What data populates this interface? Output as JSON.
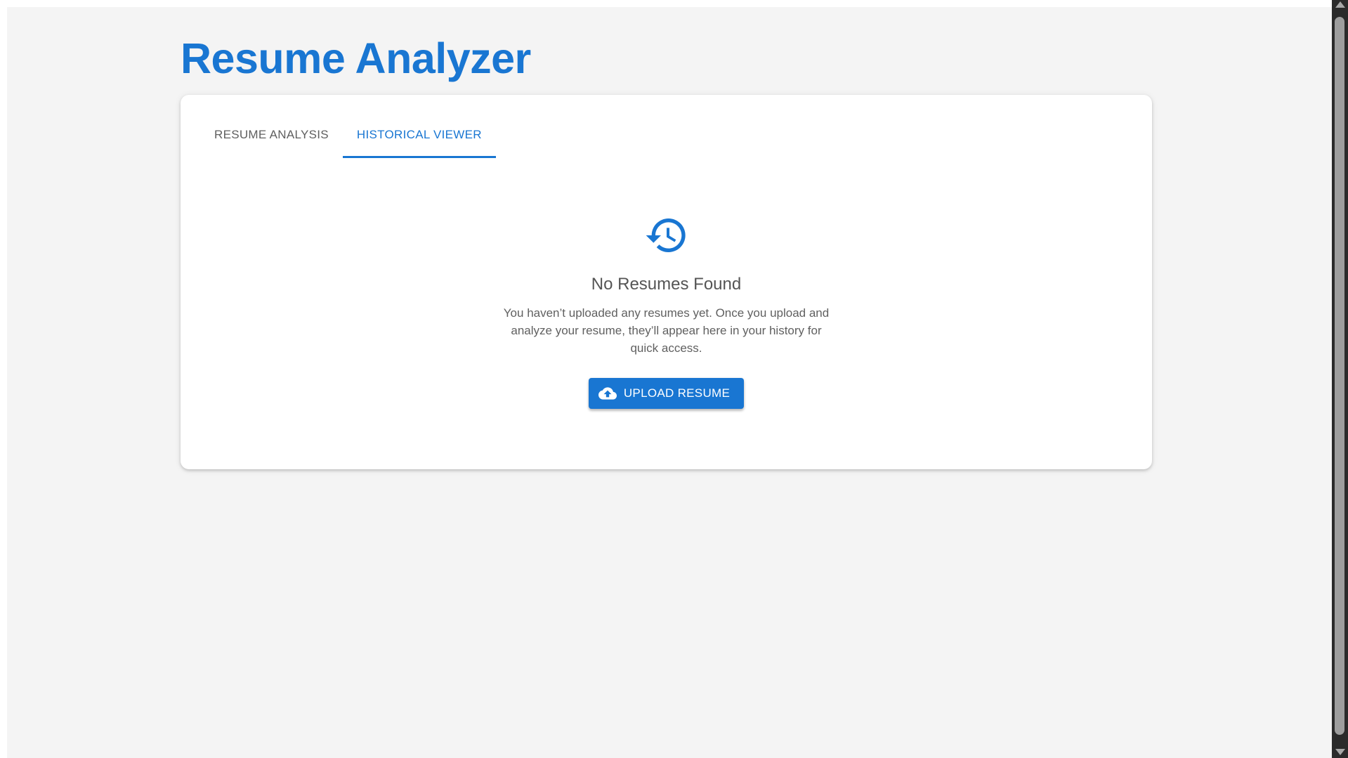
{
  "app": {
    "title": "Resume Analyzer"
  },
  "tabs": [
    {
      "label": "RESUME ANALYSIS",
      "active": false
    },
    {
      "label": "HISTORICAL VIEWER",
      "active": true
    }
  ],
  "empty_state": {
    "icon": "history-icon",
    "title": "No Resumes Found",
    "description": "You haven’t uploaded any resumes yet. Once you upload and analyze your resume, they’ll appear here in your history for quick access.",
    "button_label": "UPLOAD RESUME",
    "button_icon": "cloud-upload-icon"
  },
  "colors": {
    "primary": "#1976d2",
    "background": "#f4f4f4",
    "card": "#ffffff",
    "text_muted": "#5f5f5f"
  }
}
